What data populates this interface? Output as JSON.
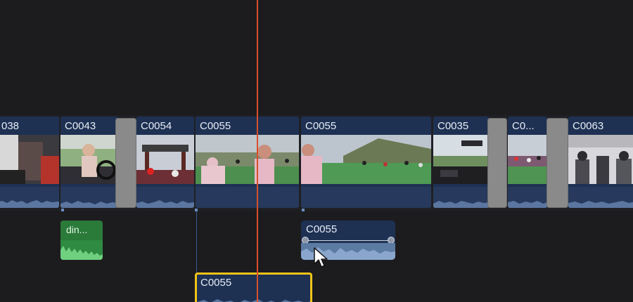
{
  "primary_storyline": {
    "clips": [
      {
        "name": "038",
        "scene": "car-interior"
      },
      {
        "name": "C0043",
        "scene": "driver"
      },
      {
        "name": "C0054",
        "scene": "gate"
      },
      {
        "name": "C0055",
        "scene": "crowd"
      },
      {
        "name": "C0055",
        "scene": "hill-crowd"
      },
      {
        "name": "C0035",
        "scene": "dashboard"
      },
      {
        "name": "C0...",
        "scene": "people"
      },
      {
        "name": "C0063",
        "scene": "van-interior"
      }
    ]
  },
  "connected_clips": {
    "green_audio": {
      "name": "din..."
    },
    "audio_clip": {
      "name": "C0055"
    },
    "selected_clip": {
      "name": "C0055"
    }
  },
  "colors": {
    "background": "#1c1c1e",
    "clip_blue": "#1e3153",
    "playhead": "#d9502d",
    "selection": "#f2c318",
    "audio_green": "#2a7a3a"
  }
}
